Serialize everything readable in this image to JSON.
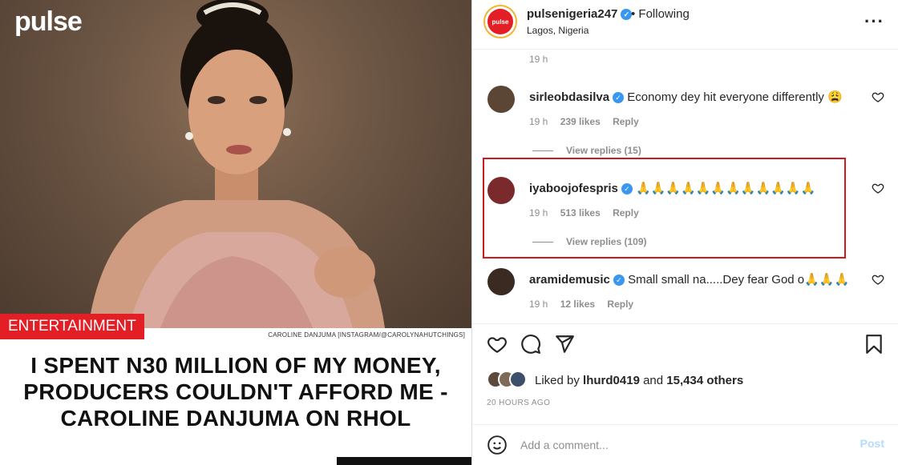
{
  "left": {
    "logo": "pulse",
    "tag": "ENTERTAINMENT",
    "credit": "CAROLINE DANJUMA [INSTAGRAM/@CAROLYNAHUTCHINGS]",
    "headline_lines": [
      "I SPENT N30 MILLION OF MY MONEY,",
      "PRODUCERS COULDN'T AFFORD ME -",
      "CAROLINE DANJUMA ON RHOL"
    ]
  },
  "header": {
    "username": "pulsenigeria247",
    "avatar_text": "pulse",
    "following": "• Following",
    "location": "Lagos, Nigeria",
    "more": "···"
  },
  "comments_top_time": "19 h",
  "comments": [
    {
      "user": "sirleobdasilva",
      "text": "Economy dey hit everyone differently 😩",
      "time": "19 h",
      "likes": "239 likes",
      "reply": "Reply",
      "view_replies": "View replies (15)",
      "avatar_color": "#5b4636"
    },
    {
      "user": "iyaboojofespris",
      "text": "🙏🙏🙏🙏🙏🙏🙏🙏🙏🙏🙏🙏",
      "time": "19 h",
      "likes": "513 likes",
      "reply": "Reply",
      "view_replies": "View replies (109)",
      "avatar_color": "#7a2a2a"
    },
    {
      "user": "aramidemusic",
      "text": "Small small na.....Dey fear God o🙏🙏🙏",
      "time": "19 h",
      "likes": "12 likes",
      "reply": "Reply",
      "view_replies": "",
      "avatar_color": "#3a2a22"
    }
  ],
  "actions": {
    "liked_by_prefix": "Liked by",
    "liked_by_user": "lhurd0419",
    "liked_by_and": "and",
    "liked_by_count": "15,434 others",
    "time_ago": "20 HOURS AGO"
  },
  "add_comment": {
    "placeholder": "Add a comment...",
    "post": "Post"
  },
  "colors": {
    "verified": "#3897f0",
    "highlight": "#d0191f",
    "tag": "#e31e24",
    "post_disabled": "#b3dbff"
  }
}
